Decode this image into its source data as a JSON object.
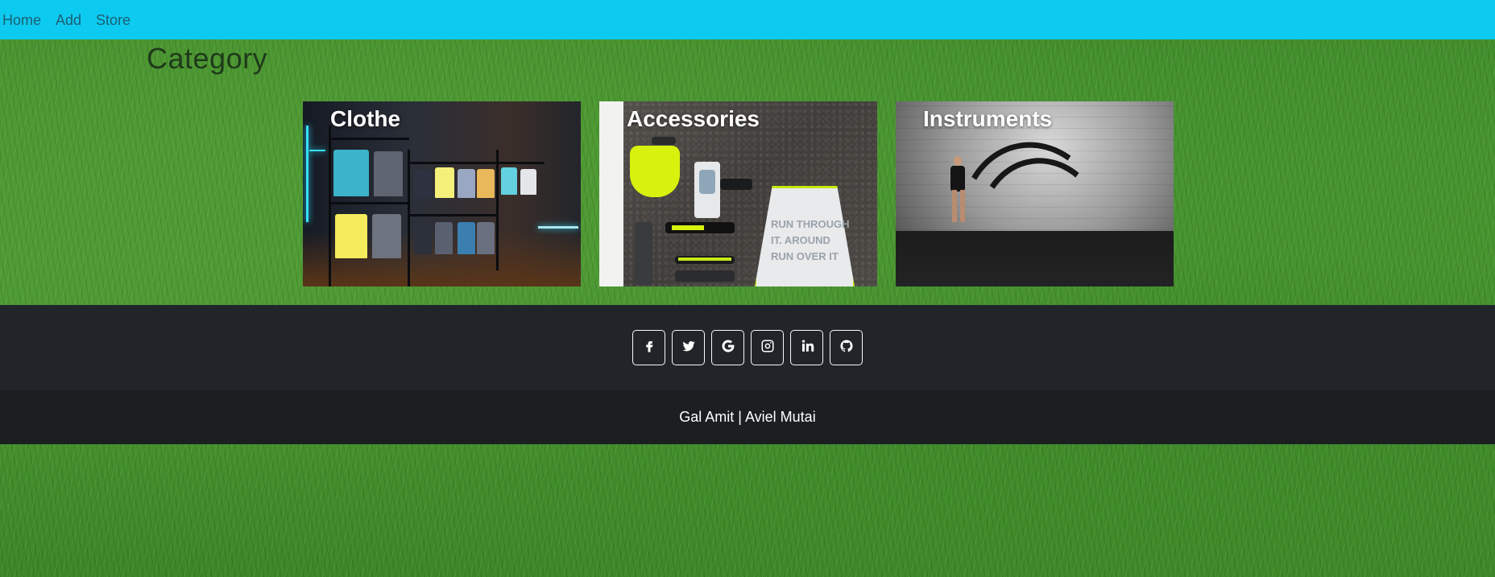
{
  "nav": {
    "items": [
      {
        "label": "Home"
      },
      {
        "label": "Add"
      },
      {
        "label": "Store"
      }
    ],
    "background": "#0dcaf0"
  },
  "page": {
    "title": "Category"
  },
  "categories": [
    {
      "label": "Clothe"
    },
    {
      "label": "Accessories"
    },
    {
      "label": "Instruments"
    }
  ],
  "footer": {
    "social": [
      {
        "icon": "facebook-icon"
      },
      {
        "icon": "twitter-icon"
      },
      {
        "icon": "google-icon"
      },
      {
        "icon": "instagram-icon"
      },
      {
        "icon": "linkedin-icon"
      },
      {
        "icon": "github-icon"
      }
    ],
    "credits": "Gal Amit | Aviel Mutai",
    "background": "#212529"
  }
}
